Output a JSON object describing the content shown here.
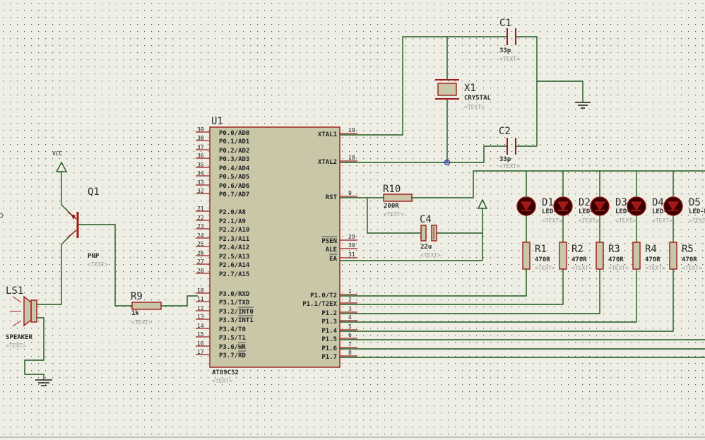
{
  "colors": {
    "background": "#eeeee4",
    "wire": "#1c5a1c",
    "outline": "#9c1b1b",
    "body": "#c9c7a8",
    "led": "#3a0000",
    "junction": "#2f3fbf"
  },
  "mcu": {
    "ref": "U1",
    "value": "AT89C52",
    "text": "<TEXT>",
    "left_pins": [
      {
        "num": "39",
        "name": "P0.0/AD0"
      },
      {
        "num": "38",
        "name": "P0.1/AD1"
      },
      {
        "num": "37",
        "name": "P0.2/AD2"
      },
      {
        "num": "36",
        "name": "P0.3/AD3"
      },
      {
        "num": "35",
        "name": "P0.4/AD4"
      },
      {
        "num": "34",
        "name": "P0.5/AD5"
      },
      {
        "num": "33",
        "name": "P0.6/AD6"
      },
      {
        "num": "32",
        "name": "P0.7/AD7"
      },
      {
        "num": "21",
        "name": "P2.0/A8"
      },
      {
        "num": "22",
        "name": "P2.1/A9"
      },
      {
        "num": "23",
        "name": "P2.2/A10"
      },
      {
        "num": "24",
        "name": "P2.3/A11"
      },
      {
        "num": "25",
        "name": "P2.4/A12"
      },
      {
        "num": "26",
        "name": "P2.5/A13"
      },
      {
        "num": "27",
        "name": "P2.6/A14"
      },
      {
        "num": "28",
        "name": "P2.7/A15"
      },
      {
        "num": "10",
        "name": "P3.0/RXD"
      },
      {
        "num": "11",
        "name": "P3.1/TXD"
      },
      {
        "num": "12",
        "name": "P3.2/INT0"
      },
      {
        "num": "13",
        "name": "P3.3/INT1"
      },
      {
        "num": "14",
        "name": "P3.4/T0"
      },
      {
        "num": "15",
        "name": "P3.5/T1"
      },
      {
        "num": "16",
        "name": "P3.6/WR"
      },
      {
        "num": "17",
        "name": "P3.7/RD"
      }
    ],
    "right_pins": [
      {
        "num": "19",
        "name": "XTAL1"
      },
      {
        "num": "18",
        "name": "XTAL2"
      },
      {
        "num": "9",
        "name": "RST"
      },
      {
        "num": "29",
        "name": "PSEN"
      },
      {
        "num": "30",
        "name": "ALE"
      },
      {
        "num": "31",
        "name": "EA"
      },
      {
        "num": "1",
        "name": "P1.0/T2"
      },
      {
        "num": "2",
        "name": "P1.1/T2EX"
      },
      {
        "num": "3",
        "name": "P1.2"
      },
      {
        "num": "4",
        "name": "P1.3"
      },
      {
        "num": "5",
        "name": "P1.4"
      },
      {
        "num": "6",
        "name": "P1.5"
      },
      {
        "num": "7",
        "name": "P1.6"
      },
      {
        "num": "8",
        "name": "P1.7"
      }
    ]
  },
  "c1": {
    "ref": "C1",
    "value": "33p",
    "text": "<TEXT>"
  },
  "c2": {
    "ref": "C2",
    "value": "33p",
    "text": "<TEXT>"
  },
  "x1": {
    "ref": "X1",
    "value": "CRYSTAL",
    "text": "<TEXT>"
  },
  "r10": {
    "ref": "R10",
    "value": "200R",
    "text": "<TEXT>"
  },
  "c4": {
    "ref": "C4",
    "value": "22u",
    "text": "<TEXT>"
  },
  "q1": {
    "ref": "Q1",
    "value": "PNP",
    "text": "<TEXT>"
  },
  "vcc": {
    "label": "VCC"
  },
  "r9": {
    "ref": "R9",
    "value": "1k",
    "text": "<TEXT>"
  },
  "ls1": {
    "ref": "LS1",
    "value": "SPEAKER",
    "text": "<TEXT>"
  },
  "leds": [
    {
      "ref": "D1",
      "value": "LED-RED",
      "text": "<TEXT>"
    },
    {
      "ref": "D2",
      "value": "LED-RED",
      "text": "<TEXT>"
    },
    {
      "ref": "D3",
      "value": "LED-RED",
      "text": "<TEXT>"
    },
    {
      "ref": "D4",
      "value": "LED-RED",
      "text": "<TEXT>"
    },
    {
      "ref": "D5",
      "value": "LED-RED",
      "text": "<TEXT>"
    }
  ],
  "resistors": [
    {
      "ref": "R1",
      "value": "470R",
      "text": "<TEXT>"
    },
    {
      "ref": "R2",
      "value": "470R",
      "text": "<TEXT>"
    },
    {
      "ref": "R3",
      "value": "470R",
      "text": "<TEXT>"
    },
    {
      "ref": "R4",
      "value": "470R",
      "text": "<TEXT>"
    },
    {
      "ref": "R5",
      "value": "470R",
      "text": "<TEXT>"
    }
  ]
}
